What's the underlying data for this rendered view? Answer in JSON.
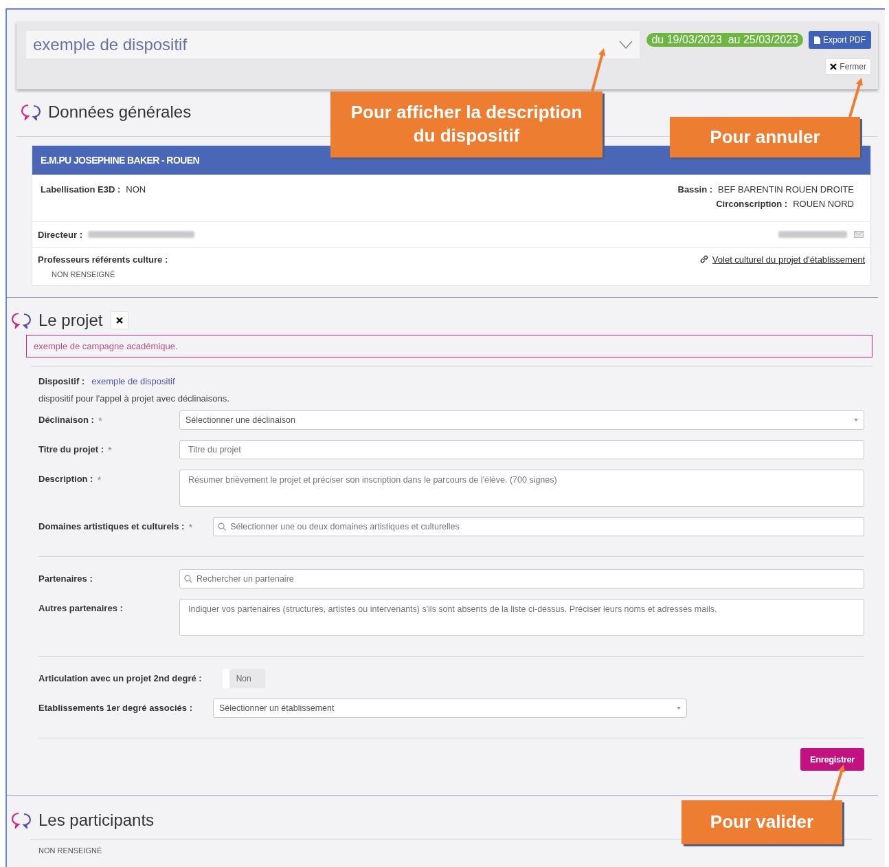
{
  "header": {
    "title": "exemple de dispositif",
    "dates": "du 19/03/2023  au 25/03/2023",
    "export_button": "Export PDF",
    "close_button": "Fermer"
  },
  "general": {
    "title": "Données générales",
    "school": "E.M.PU JOSEPHINE BAKER - ROUEN",
    "fields_left": [
      {
        "label": "Labellisation E3D :",
        "value": "NON"
      }
    ],
    "fields_right": [
      {
        "label": "Bassin :",
        "value": "BEF BARENTIN ROUEN DROITE"
      },
      {
        "label": "Circonscription :",
        "value": "ROUEN NORD"
      }
    ],
    "director_label": "Directeur :",
    "referents_label": "Professeurs référents culture :",
    "referents_value": "NON RENSEIGNÉ",
    "link": "Volet culturel du projet d'établissement"
  },
  "project": {
    "title": "Le projet",
    "campaign": "exemple de campagne académique.",
    "dispositif_label": "Dispositif :",
    "dispositif_value": "exemple de dispositif",
    "dispositif_desc": "dispositif pour l'appel à projet avec déclinaisons.",
    "groups": [
      {
        "fields": [
          {
            "kind": "select",
            "label": "Déclinaison :",
            "required": "*",
            "placeholder": "Sélectionner une déclinaison"
          },
          {
            "kind": "input",
            "label": "Titre du projet :",
            "required": "*",
            "placeholder": "Titre du projet"
          },
          {
            "kind": "textarea",
            "label": "Description :",
            "required": "*",
            "placeholder": "Résumer brièvement le projet et préciser son inscription dans le parcours de l'élève. (700 signes)"
          },
          {
            "kind": "search",
            "label": "Domaines artistiques et culturels :",
            "required": "*",
            "placeholder": "Sélectionner une ou deux domaines artistiques et culturelles"
          }
        ]
      },
      {
        "fields": [
          {
            "kind": "search",
            "label": "Partenaires :",
            "placeholder": "Rechercher un partenaire"
          },
          {
            "kind": "textarea",
            "label": "Autres partenaires :",
            "placeholder": "Indiquer vos partenaires (structures, artistes ou intervenants) s'ils sont absents de la liste ci-dessus. Préciser leurs noms et adresses mails."
          }
        ]
      },
      {
        "fields": [
          {
            "kind": "toggle",
            "label": "Articulation avec un projet 2nd degré :",
            "value": "Non",
            "on": false
          },
          {
            "kind": "select",
            "label": "Etablissements 1er degré associés :",
            "placeholder": "Sélectionner un établissement"
          }
        ]
      }
    ],
    "save_button": "Enregistrer"
  },
  "participants": {
    "title": "Les participants",
    "value": "NON RENSEIGNÉ"
  },
  "callouts": [
    {
      "text": "Pour afficher la description du dispositif"
    },
    {
      "text": "Pour annuler"
    },
    {
      "text": "Pour valider"
    }
  ]
}
